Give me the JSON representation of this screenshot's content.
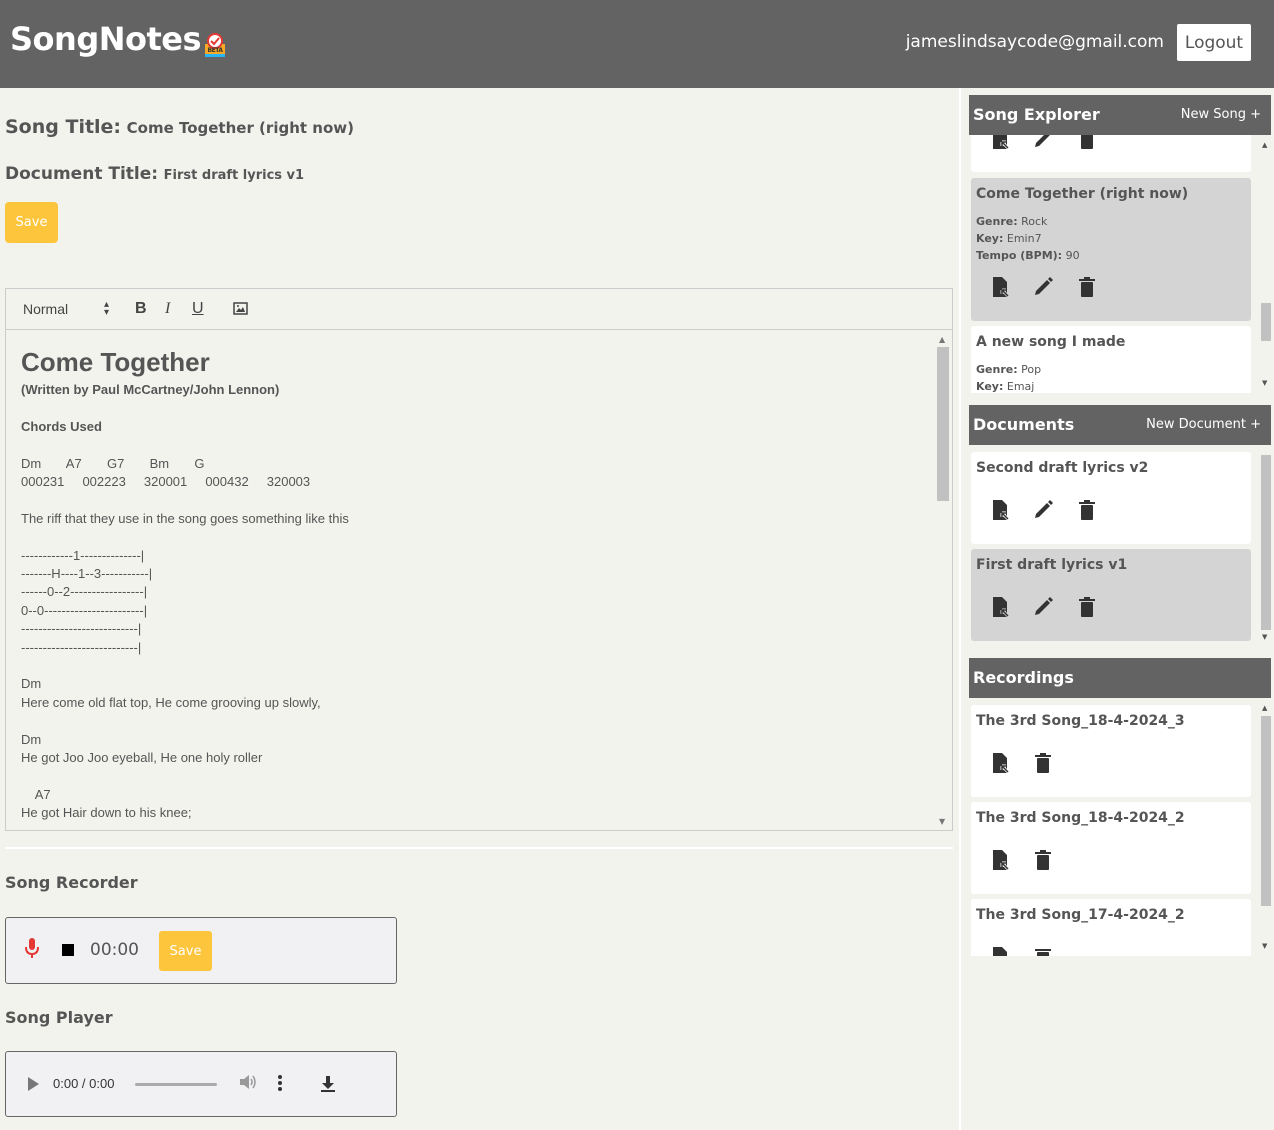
{
  "app": {
    "brand": "SongNotes",
    "user_email": "jameslindsaycode@gmail.com",
    "logout_label": "Logout"
  },
  "song_title": {
    "label": "Song Title:",
    "value": "Come Together (right now)"
  },
  "document_title": {
    "label": "Document Title:",
    "value": "First draft lyrics v1"
  },
  "save_label": "Save",
  "editor": {
    "format_select": "Normal",
    "bold": "B",
    "italic": "I",
    "underline": "U",
    "heading": "Come Together",
    "lines": [
      {
        "text": "(Written by Paul McCartney/John Lennon)",
        "bold": true
      },
      {
        "text": "",
        "bold": false
      },
      {
        "text": "Chords Used",
        "bold": true
      },
      {
        "text": "",
        "bold": false
      },
      {
        "text": "Dm       A7       G7       Bm       G",
        "bold": false
      },
      {
        "text": "000231     002223     320001     000432     320003",
        "bold": false
      },
      {
        "text": "",
        "bold": false
      },
      {
        "text": "The riff that they use in the song goes something like this",
        "bold": false
      },
      {
        "text": "",
        "bold": false
      },
      {
        "text": "------------1--------------|",
        "bold": false
      },
      {
        "text": "-------H----1--3-----------|",
        "bold": false
      },
      {
        "text": "------0--2-----------------|",
        "bold": false
      },
      {
        "text": "0--0-----------------------|",
        "bold": false
      },
      {
        "text": "---------------------------|",
        "bold": false
      },
      {
        "text": "---------------------------|",
        "bold": false
      },
      {
        "text": "",
        "bold": false
      },
      {
        "text": "Dm",
        "bold": false
      },
      {
        "text": "Here come old flat top, He come grooving up slowly,",
        "bold": false
      },
      {
        "text": "",
        "bold": false
      },
      {
        "text": "Dm",
        "bold": false
      },
      {
        "text": "He got Joo Joo eyeball, He one holy roller",
        "bold": false
      },
      {
        "text": "",
        "bold": false
      },
      {
        "text": "    A7",
        "bold": false
      },
      {
        "text": "He got Hair down to his knee;",
        "bold": false
      }
    ]
  },
  "recorder": {
    "label": "Song Recorder",
    "time": "00:00",
    "save_label": "Save"
  },
  "player": {
    "label": "Song Player",
    "time": "0:00 / 0:00"
  },
  "song_explorer": {
    "title": "Song Explorer",
    "action": "New Song +",
    "songs": [
      {
        "title": "Come Together (right now)",
        "genre_label": "Genre:",
        "genre": "Rock",
        "key_label": "Key:",
        "key": "Emin7",
        "tempo_label": "Tempo (BPM):",
        "tempo": "90"
      },
      {
        "title": "A new song I made",
        "genre_label": "Genre:",
        "genre": "Pop",
        "key_label": "Key:",
        "key": "Emaj"
      }
    ]
  },
  "documents": {
    "title": "Documents",
    "action": "New Document +",
    "items": [
      {
        "title": "Second draft lyrics v2"
      },
      {
        "title": "First draft lyrics v1"
      }
    ]
  },
  "recordings": {
    "title": "Recordings",
    "items": [
      {
        "title": "The 3rd Song_18-4-2024_3"
      },
      {
        "title": "The 3rd Song_18-4-2024_2"
      },
      {
        "title": "The 3rd Song_17-4-2024_2"
      }
    ]
  }
}
